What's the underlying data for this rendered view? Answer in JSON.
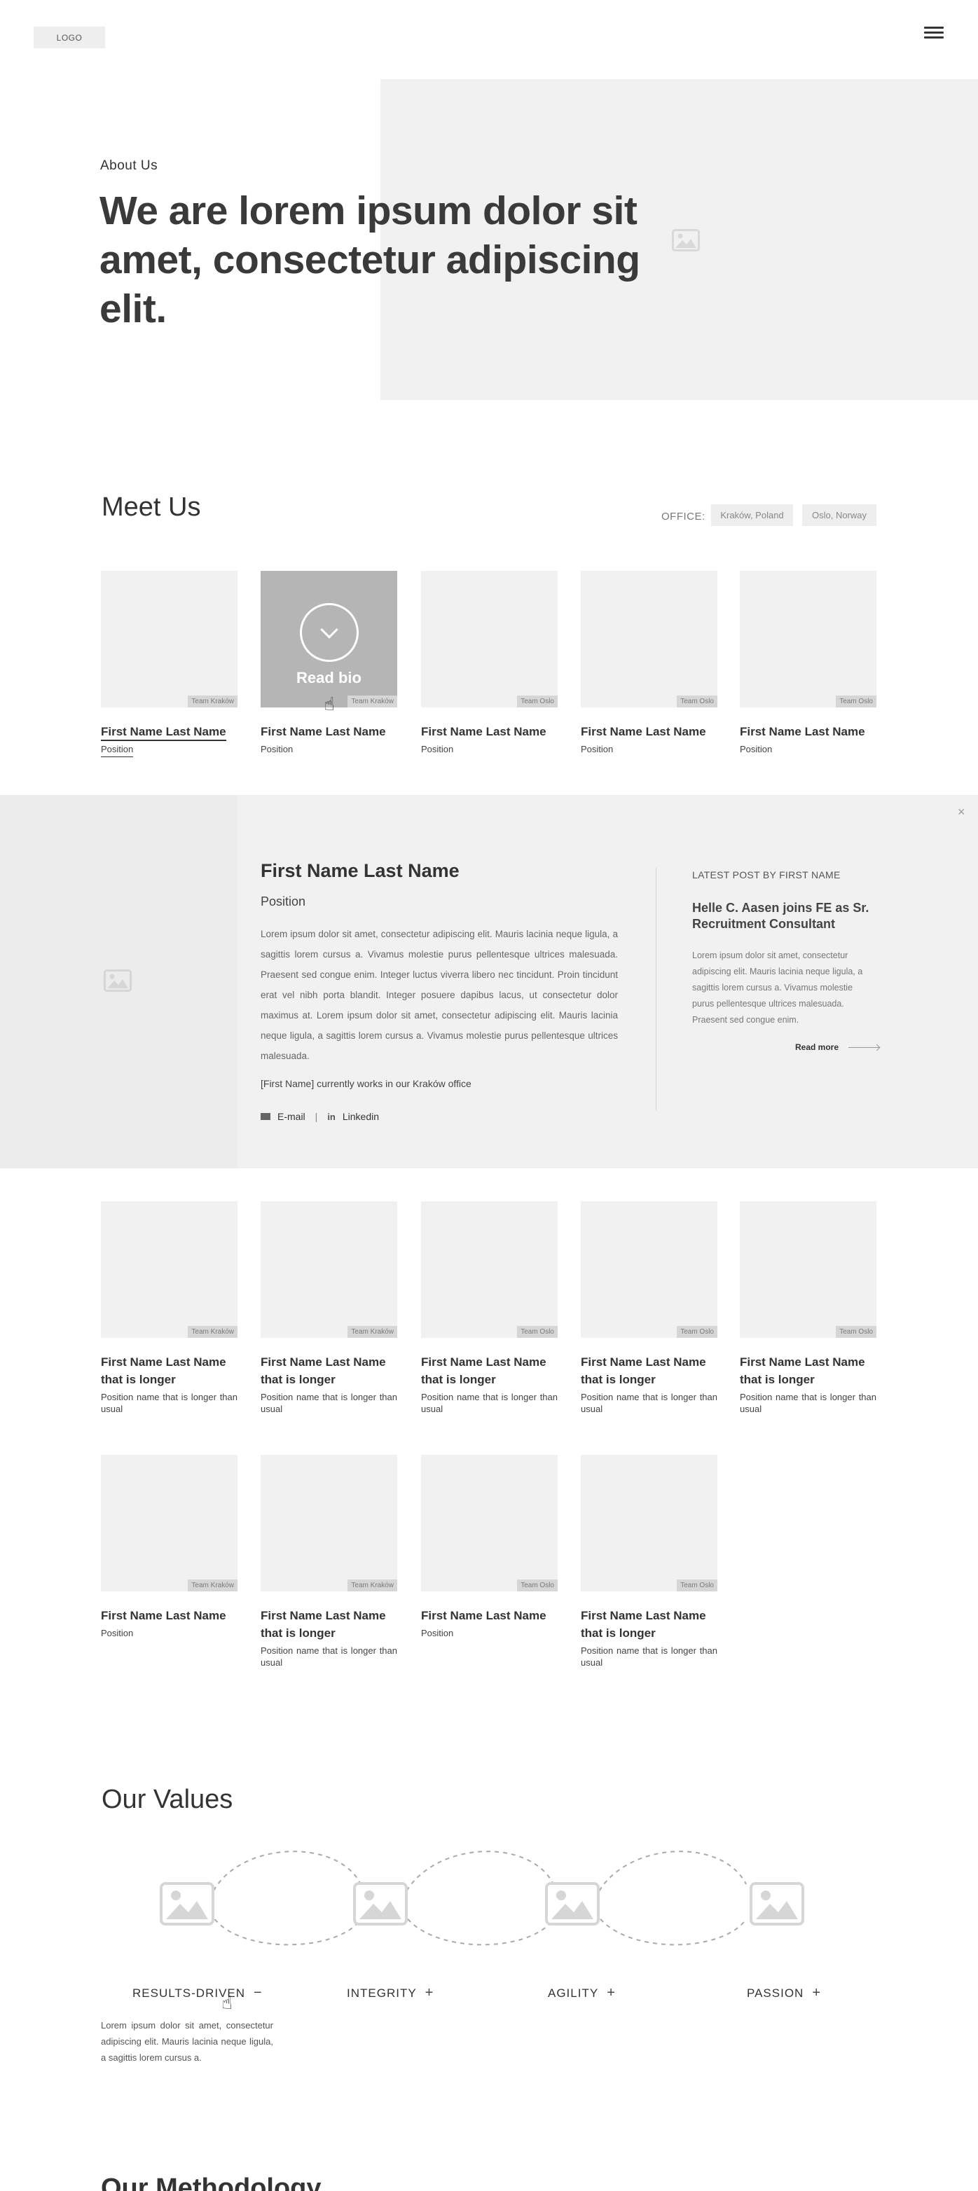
{
  "header": {
    "logo": "LOGO"
  },
  "hero": {
    "eyebrow": "About Us",
    "title": "We are lorem ipsum dolor sit amet, consectetur adipiscing elit."
  },
  "meet": {
    "title": "Meet Us",
    "office_label": "OFFICE:",
    "offices": [
      "Kraków, Poland",
      "Oslo, Norway"
    ],
    "read_bio": "Read bio",
    "row1": [
      {
        "name": "First Name Last Name",
        "position": "Position",
        "team": "Team Kraków"
      },
      {
        "name": "First Name Last Name",
        "position": "Position",
        "team": "Team Kraków"
      },
      {
        "name": "First Name Last Name",
        "position": "Position",
        "team": "Team Oslo"
      },
      {
        "name": "First Name Last Name",
        "position": "Position",
        "team": "Team Oslo"
      },
      {
        "name": "First Name Last Name",
        "position": "Position",
        "team": "Team Oslo"
      }
    ],
    "row2": [
      {
        "name": "First Name Last Name that is longer",
        "position": "Position name that is longer than usual",
        "team": "Team Kraków"
      },
      {
        "name": "First Name Last Name that is longer",
        "position": "Position name that is longer than usual",
        "team": "Team Kraków"
      },
      {
        "name": "First Name Last Name that is longer",
        "position": "Position name that is longer than usual",
        "team": "Team Oslo"
      },
      {
        "name": "First Name Last Name that is longer",
        "position": "Position name that is longer than usual",
        "team": "Team Oslo"
      },
      {
        "name": "First Name Last Name that is longer",
        "position": "Position name that is longer than usual",
        "team": "Team Oslo"
      }
    ],
    "row3": [
      {
        "name": "First Name Last Name",
        "position": "Position",
        "team": "Team Kraków"
      },
      {
        "name": "First Name Last Name that is longer",
        "position": "Position name that is longer than usual",
        "team": "Team Kraków"
      },
      {
        "name": "First Name Last Name",
        "position": "Position",
        "team": "Team Oslo"
      },
      {
        "name": "First Name Last Name that is longer",
        "position": "Position name that is longer than usual",
        "team": "Team Oslo"
      }
    ]
  },
  "bio": {
    "close": "×",
    "name": "First Name Last Name",
    "position": "Position",
    "text": "Lorem ipsum dolor sit amet, consectetur adipiscing elit. Mauris lacinia neque ligula, a sagittis lorem cursus a. Vivamus molestie purus pellentesque ultrices malesuada. Praesent sed congue enim. Integer luctus viverra libero nec tincidunt. Proin tincidunt erat vel nibh porta blandit. Integer posuere dapibus lacus, ut consectetur dolor maximus at. Lorem ipsum dolor sit amet, consectetur adipiscing elit. Mauris lacinia neque ligula, a sagittis lorem cursus a. Vivamus molestie purus pellentesque ultrices malesuada.",
    "office_note": "[First Name] currently works in our Kraków office",
    "email_label": "E-mail",
    "separator": "|",
    "linkedin_label": "Linkedin",
    "linkedin_glyph": "in",
    "latest_label": "LATEST POST BY FIRST NAME",
    "latest_title": "Helle C. Aasen joins FE as Sr. Recruitment Consultant",
    "latest_text": "Lorem ipsum dolor sit amet, consectetur adipiscing elit. Mauris lacinia neque ligula, a sagittis lorem cursus a. Vivamus molestie purus pellentesque ultrices malesuada. Praesent sed congue enim.",
    "read_more": "Read more"
  },
  "values": {
    "title": "Our Values",
    "items": [
      {
        "label": "RESULTS-DRIVEN",
        "toggle": "−"
      },
      {
        "label": "INTEGRITY",
        "toggle": "+"
      },
      {
        "label": "AGILITY",
        "toggle": "+"
      },
      {
        "label": "PASSION",
        "toggle": "+"
      }
    ],
    "description": "Lorem ipsum dolor sit amet, consectetur adipiscing elit. Mauris lacinia neque ligula, a sagittis lorem cursus a."
  },
  "next_section": {
    "title": "Our Methodology"
  },
  "colors": {
    "placeholder": "#f1f1f1",
    "panel": "#f1f1f1",
    "hover": "#b5b5b5",
    "text": "#333333"
  },
  "icons": {
    "image": "image-placeholder-icon",
    "menu": "hamburger-icon",
    "cursor": "hand-pointer-icon",
    "mail": "mail-icon",
    "linkedin": "linkedin-icon"
  }
}
